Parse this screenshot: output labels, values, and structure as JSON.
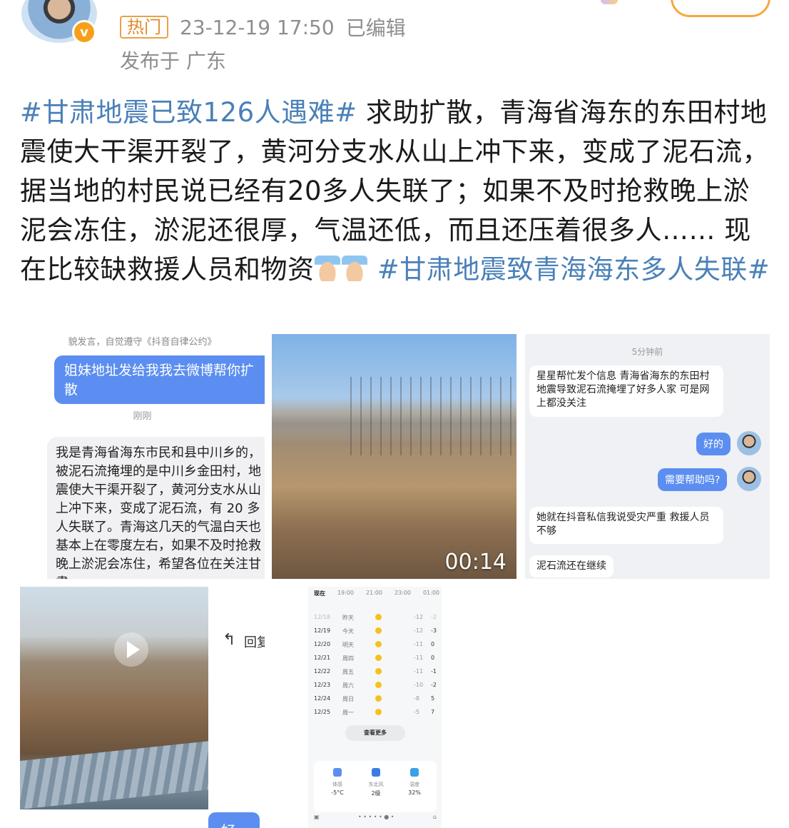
{
  "header": {
    "verified_badge": "v",
    "hot_tag": "热门",
    "timestamp": "23-12-19 17:50",
    "edited": "已编辑",
    "location": "发布于 广东"
  },
  "post": {
    "hashtag1": "#甘肃地震已致126人遇难#",
    "body": " 求助扩散，青海省海东的东田村地震使大干渠开裂了，黄河分支水从山上冲下来，变成了泥石流，据当地的村民说已经有20多人失联了；如果不及时抢救晚上淤泥会冻住，淤泥还很厚，气温还低，而且还压着很多人…… 现在比较缺救援人员和物资",
    "emoji": "folded-hands-emoji",
    "hashtag2": "#甘肃地震致青海海东多人失联#"
  },
  "images": {
    "chat1": {
      "notice": "貌发言，自觉遵守《抖音自律公约》",
      "sent": "姐妹地址发给我我去微博帮你扩散",
      "time": "刚刚",
      "received": "我是青海省海东市民和县中川乡的，被泥石流掩埋的是中川乡金田村，地震使大干渠开裂了，黄河分支水从山上冲下来，变成了泥石流，有 20 多人失联了。青海这几天的气温白天也基本上在零度左右，如果不及时抢救晚上淤泥会冻住，希望各位在关注甘肃"
    },
    "video": {
      "duration": "00:14"
    },
    "chat2": {
      "time": "5分钟前",
      "msg1": "星星帮忙发个信息 青海省海东的东田村 地震导致泥石流掩埋了好多人家 可是网上都没关注",
      "reply1": "好的",
      "reply2": "需要帮助吗?",
      "msg2": "她就在抖音私信我说受灾严重 救援人员不够",
      "msg3": "泥石流还在继续"
    },
    "frame": {
      "reply_label": "回复",
      "bubble": "好了"
    },
    "weather": {
      "hours": [
        "现在",
        "19:00",
        "21:00",
        "23:00",
        "01:00"
      ],
      "days": [
        {
          "date": "12/18",
          "weekday": "昨天",
          "low": "-12",
          "high": "-2",
          "past": true
        },
        {
          "date": "12/19",
          "weekday": "今天",
          "low": "-12",
          "high": "-3"
        },
        {
          "date": "12/20",
          "weekday": "明天",
          "low": "-11",
          "high": "0"
        },
        {
          "date": "12/21",
          "weekday": "周四",
          "low": "-11",
          "high": "0"
        },
        {
          "date": "12/22",
          "weekday": "周五",
          "low": "-11",
          "high": "-1"
        },
        {
          "date": "12/23",
          "weekday": "周六",
          "low": "-10",
          "high": "-2"
        },
        {
          "date": "12/24",
          "weekday": "周日",
          "low": "-8",
          "high": "5"
        },
        {
          "date": "12/25",
          "weekday": "周一",
          "low": "-5",
          "high": "7"
        }
      ],
      "more": "查看更多",
      "stats": [
        {
          "label": "体感",
          "value": "-5°C",
          "color": "#5b8ef0"
        },
        {
          "label": "东北风",
          "value": "2级",
          "color": "#3d7be0"
        },
        {
          "label": "湿度",
          "value": "32%",
          "color": "#3aa0e8"
        }
      ]
    }
  }
}
